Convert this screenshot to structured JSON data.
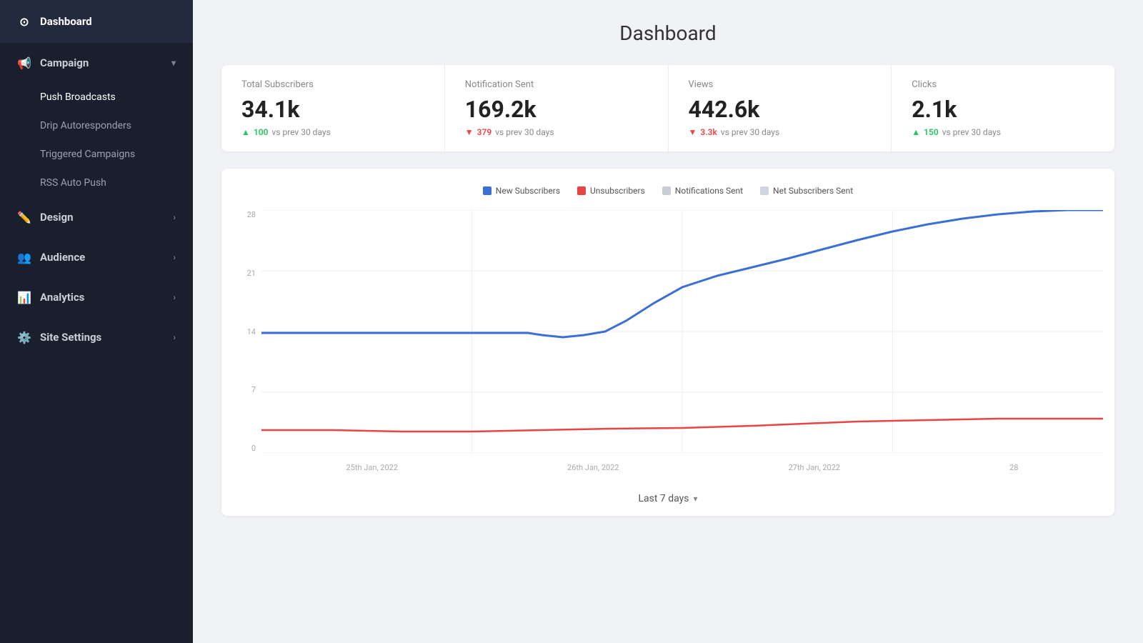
{
  "sidebar": {
    "dashboard_label": "Dashboard",
    "campaign_label": "Campaign",
    "campaign_chevron": "▾",
    "push_broadcasts_label": "Push Broadcasts",
    "drip_autoresponders_label": "Drip Autoresponders",
    "triggered_campaigns_label": "Triggered Campaigns",
    "rss_auto_push_label": "RSS Auto Push",
    "design_label": "Design",
    "design_chevron": "›",
    "audience_label": "Audience",
    "audience_chevron": "›",
    "analytics_label": "Analytics",
    "analytics_chevron": "›",
    "site_settings_label": "Site Settings",
    "site_settings_chevron": "›"
  },
  "main": {
    "page_title": "Dashboard",
    "stats": [
      {
        "label": "Total Subscribers",
        "value": "34.1k",
        "change_value": "100",
        "change_direction": "up",
        "change_text": "vs prev 30 days"
      },
      {
        "label": "Notification Sent",
        "value": "169.2k",
        "change_value": "379",
        "change_direction": "down",
        "change_text": "vs prev 30 days"
      },
      {
        "label": "Views",
        "value": "442.6k",
        "change_value": "3.3k",
        "change_direction": "down",
        "change_text": "vs prev 30 days"
      },
      {
        "label": "Clicks",
        "value": "2.1k",
        "change_value": "150",
        "change_direction": "up",
        "change_text": "vs prev 30 days"
      }
    ],
    "chart": {
      "legend": [
        {
          "label": "New Subscribers",
          "color": "#3b6fd4"
        },
        {
          "label": "Unsubscribers",
          "color": "#e84444"
        },
        {
          "label": "Notifications Sent",
          "color": "#c8cdd8"
        },
        {
          "label": "Net Subscribers Sent",
          "color": "#d0d4de"
        }
      ],
      "y_labels": [
        "28",
        "21",
        "14",
        "7",
        "0"
      ],
      "x_labels": [
        "25th Jan, 2022",
        "26th Jan, 2022",
        "27th Jan, 2022",
        "28"
      ],
      "time_filter": "Last 7 days"
    }
  },
  "icons": {
    "dashboard": "⊙",
    "campaign": "📢",
    "design": "✏️",
    "audience": "👥",
    "analytics": "📊",
    "site_settings": "⚙️"
  }
}
